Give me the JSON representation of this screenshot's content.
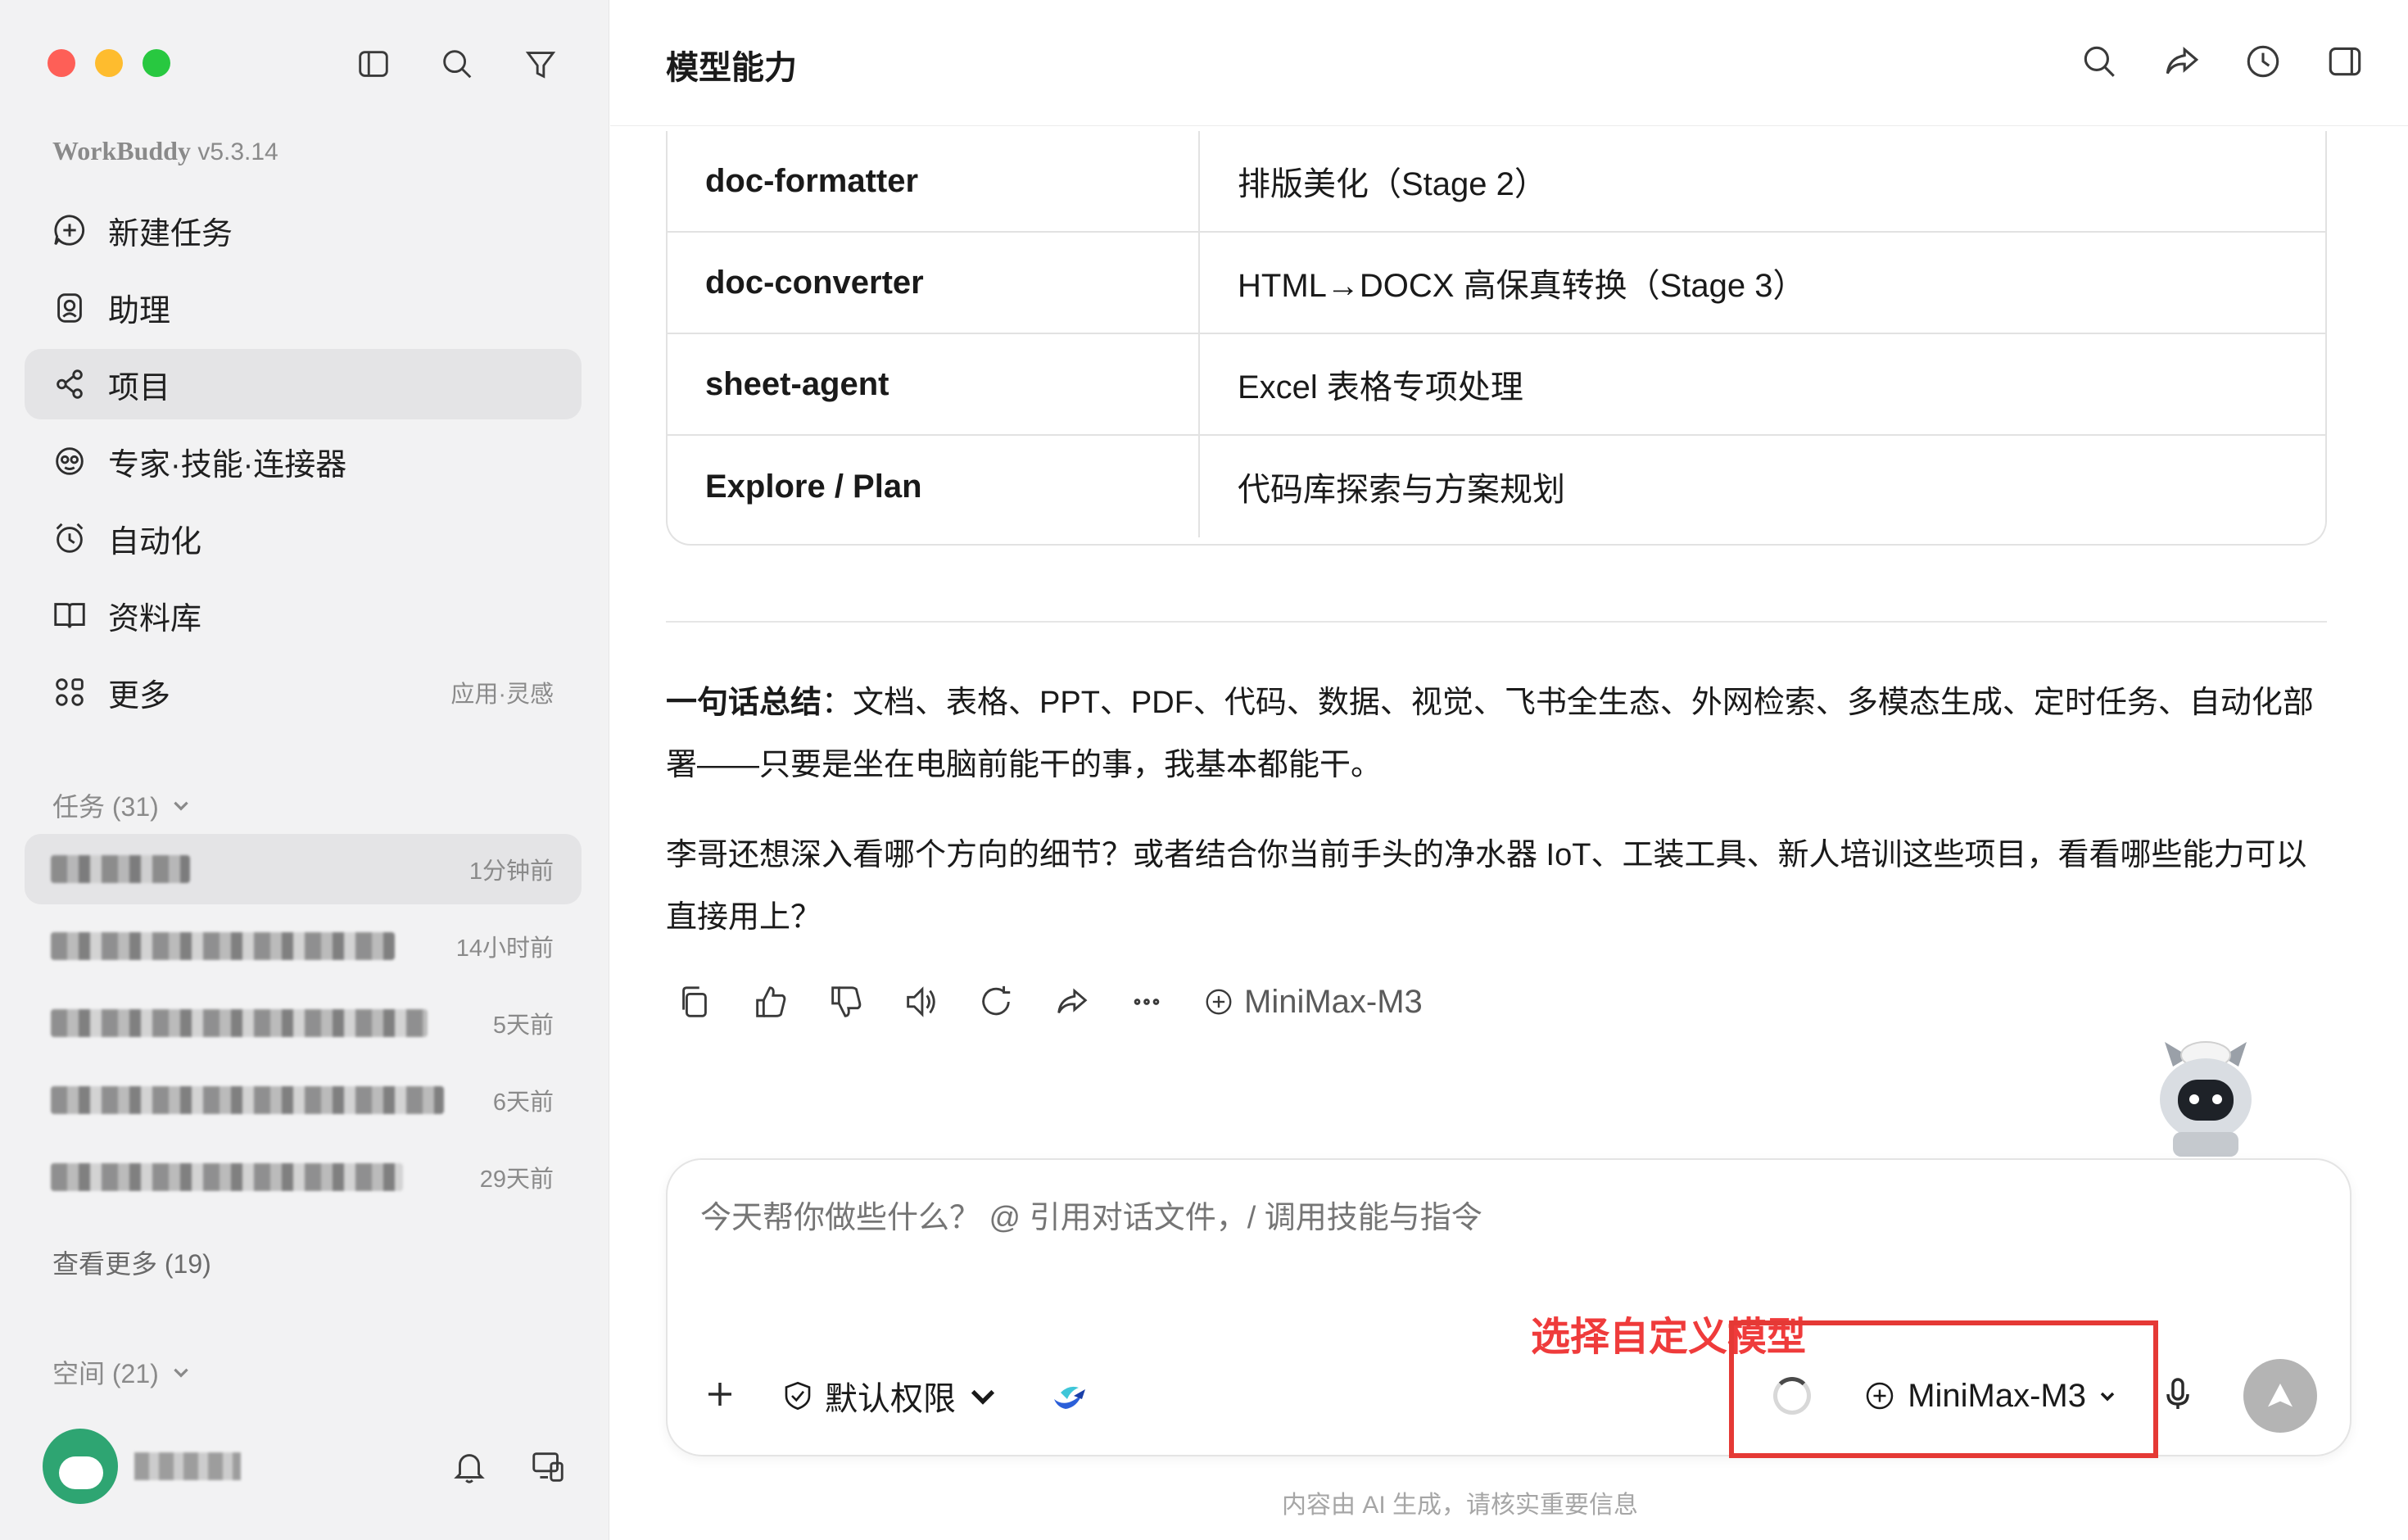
{
  "window": {
    "app_name": "WorkBuddy",
    "version": "v5.3.14",
    "page_title": "模型能力"
  },
  "sidebar": {
    "nav": [
      {
        "label": "新建任务",
        "icon": "new-task-icon"
      },
      {
        "label": "助理",
        "icon": "assistant-icon"
      },
      {
        "label": "项目",
        "icon": "project-icon"
      },
      {
        "label": "专家·技能·连接器",
        "icon": "expert-icon"
      },
      {
        "label": "自动化",
        "icon": "alarm-icon"
      },
      {
        "label": "资料库",
        "icon": "book-icon"
      },
      {
        "label": "更多",
        "icon": "more-apps-icon",
        "extra": "应用·灵感"
      }
    ],
    "tasks_header": "任务 (31)",
    "tasks": [
      {
        "time": "1分钟前",
        "active": true
      },
      {
        "time": "14小时前"
      },
      {
        "time": "5天前"
      },
      {
        "time": "6天前"
      },
      {
        "time": "29天前"
      }
    ],
    "see_more": "查看更多 (19)",
    "spaces_header": "空间 (21)"
  },
  "table": {
    "rows": [
      {
        "name": "doc-formatter",
        "desc": "排版美化（Stage 2）"
      },
      {
        "name": "doc-converter",
        "desc": "HTML→DOCX 高保真转换（Stage 3）"
      },
      {
        "name": "sheet-agent",
        "desc": "Excel 表格专项处理"
      },
      {
        "name": "Explore / Plan",
        "desc": "代码库探索与方案规划"
      }
    ]
  },
  "message": {
    "summary_label": "一句话总结",
    "summary_text": "：文档、表格、PPT、PDF、代码、数据、视觉、飞书全生态、外网检索、多模态生成、定时任务、自动化部署——只要是坐在电脑前能干的事，我基本都能干。",
    "followup": "李哥还想深入看哪个方向的细节？或者结合你当前手头的净水器 IoT、工装工具、新人培训这些项目，看看哪些能力可以直接用上？",
    "model_tag": "MiniMax-M3"
  },
  "composer": {
    "placeholder": "今天帮你做些什么？ @ 引用对话文件，/ 调用技能与指令",
    "permission_label": "默认权限",
    "model_label": "MiniMax-M3"
  },
  "annotation": {
    "callout": "选择自定义模型",
    "color": "#e53935"
  },
  "footer": {
    "disclaimer": "内容由 AI 生成，请核实重要信息"
  }
}
